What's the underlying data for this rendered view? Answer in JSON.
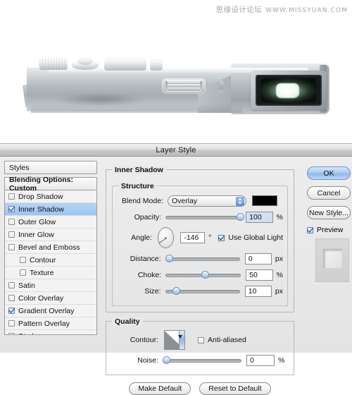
{
  "watermark": {
    "brand": "思缘设计论坛",
    "url": "WWW.MISSYUAN.COM"
  },
  "photo": {
    "alt": "silver compact camera top view with lens glow"
  },
  "dialog": {
    "title": "Layer Style",
    "styles_panel": {
      "header": "Styles",
      "blending_options": "Blending Options: Custom",
      "effects": [
        {
          "label": "Drop Shadow",
          "checked": false,
          "selected": false,
          "indent": false
        },
        {
          "label": "Inner Shadow",
          "checked": true,
          "selected": true,
          "indent": false
        },
        {
          "label": "Outer Glow",
          "checked": false,
          "selected": false,
          "indent": false
        },
        {
          "label": "Inner Glow",
          "checked": false,
          "selected": false,
          "indent": false
        },
        {
          "label": "Bevel and Emboss",
          "checked": false,
          "selected": false,
          "indent": false
        },
        {
          "label": "Contour",
          "checked": false,
          "selected": false,
          "indent": true
        },
        {
          "label": "Texture",
          "checked": false,
          "selected": false,
          "indent": true
        },
        {
          "label": "Satin",
          "checked": false,
          "selected": false,
          "indent": false
        },
        {
          "label": "Color Overlay",
          "checked": false,
          "selected": false,
          "indent": false
        },
        {
          "label": "Gradient Overlay",
          "checked": true,
          "selected": false,
          "indent": false
        },
        {
          "label": "Pattern Overlay",
          "checked": false,
          "selected": false,
          "indent": false
        },
        {
          "label": "Stroke",
          "checked": false,
          "selected": false,
          "indent": false
        }
      ]
    },
    "settings": {
      "group_title": "Inner Shadow",
      "structure_title": "Structure",
      "quality_title": "Quality",
      "blend_mode": {
        "label": "Blend Mode:",
        "value": "Overlay",
        "color": "#000000"
      },
      "opacity": {
        "label": "Opacity:",
        "value": "100",
        "unit": "%",
        "percent": 100
      },
      "angle": {
        "label": "Angle:",
        "value": "-146",
        "unit": "°",
        "degrees": -146,
        "global_light_label": "Use Global Light",
        "global_light_checked": true
      },
      "distance": {
        "label": "Distance:",
        "value": "0",
        "unit": "px",
        "percent": 0
      },
      "choke": {
        "label": "Choke:",
        "value": "50",
        "unit": "%",
        "percent": 50
      },
      "size": {
        "label": "Size:",
        "value": "10",
        "unit": "px",
        "percent": 10
      },
      "contour": {
        "label": "Contour:",
        "anti_aliased_label": "Anti-aliased",
        "anti_aliased_checked": false
      },
      "noise": {
        "label": "Noise:",
        "value": "0",
        "unit": "%",
        "percent": 0
      },
      "make_default": "Make Default",
      "reset_to_default": "Reset to Default"
    },
    "buttons": {
      "ok": "OK",
      "cancel": "Cancel",
      "new_style": "New Style...",
      "preview": "Preview",
      "preview_checked": true
    }
  },
  "colors": {
    "accent": "#9cc4ef",
    "dialog_bg": "#ebebeb",
    "swatch": "#000000"
  }
}
